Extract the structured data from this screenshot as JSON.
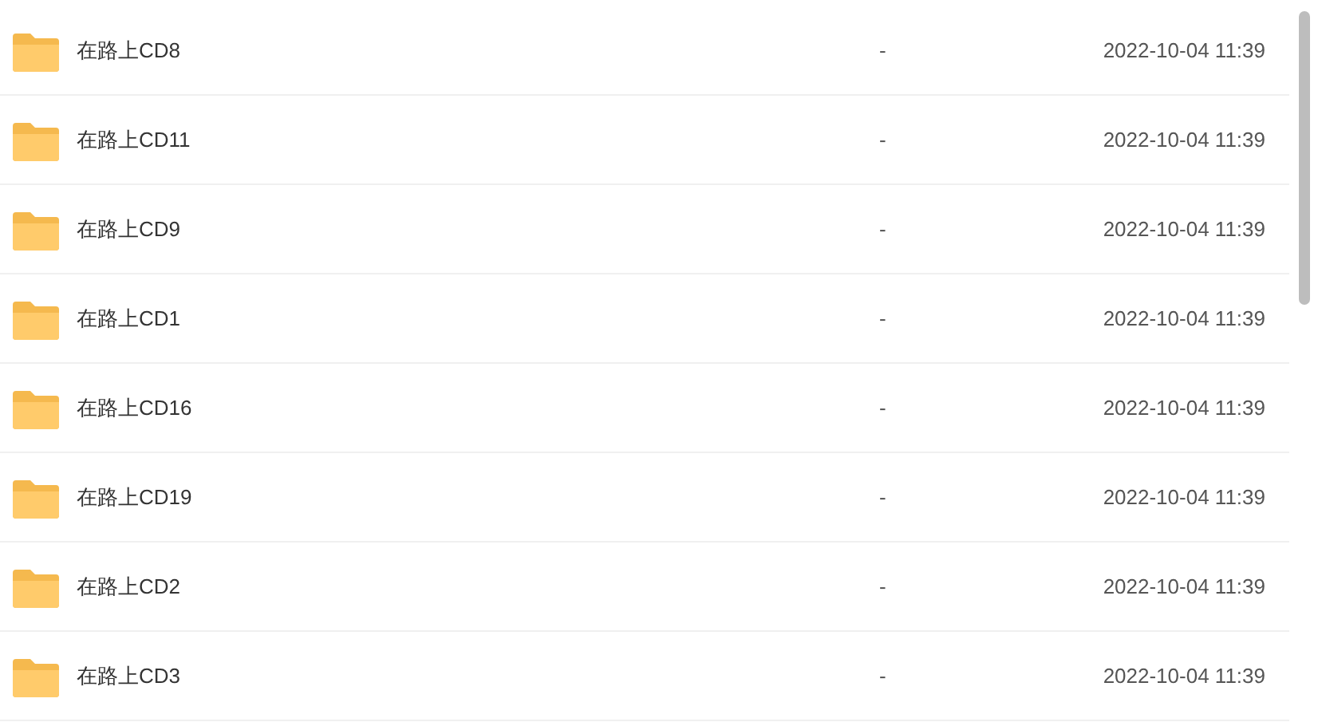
{
  "files": [
    {
      "name": "在路上CD8",
      "size": "-",
      "modified": "2022-10-04 11:39"
    },
    {
      "name": "在路上CD11",
      "size": "-",
      "modified": "2022-10-04 11:39"
    },
    {
      "name": "在路上CD9",
      "size": "-",
      "modified": "2022-10-04 11:39"
    },
    {
      "name": "在路上CD1",
      "size": "-",
      "modified": "2022-10-04 11:39"
    },
    {
      "name": "在路上CD16",
      "size": "-",
      "modified": "2022-10-04 11:39"
    },
    {
      "name": "在路上CD19",
      "size": "-",
      "modified": "2022-10-04 11:39"
    },
    {
      "name": "在路上CD2",
      "size": "-",
      "modified": "2022-10-04 11:39"
    },
    {
      "name": "在路上CD3",
      "size": "-",
      "modified": "2022-10-04 11:39"
    }
  ]
}
